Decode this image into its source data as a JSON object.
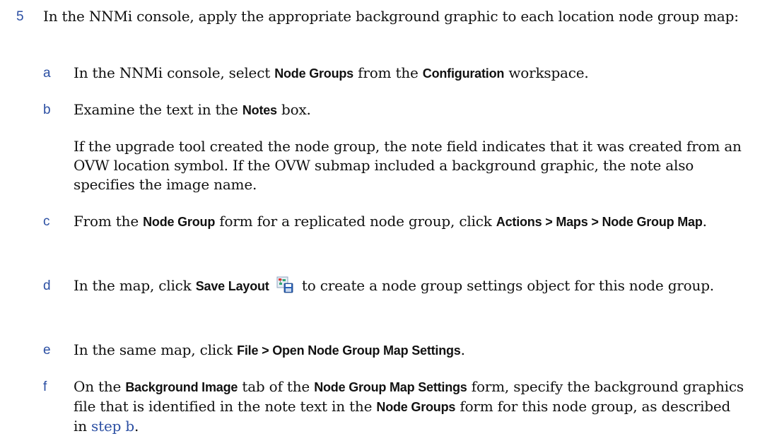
{
  "step": {
    "number": "5",
    "text": "In the NNMi console, apply the appropriate background graphic to each location node group map:"
  },
  "substeps": {
    "a": {
      "marker": "a",
      "t1": "In the NNMi console, select ",
      "b1": "Node Groups",
      "t2": " from the ",
      "b2": "Configuration",
      "t3": " workspace."
    },
    "b": {
      "marker": "b",
      "t1": "Examine the text in the ",
      "b1": "Notes",
      "t2": " box.",
      "para": "If the upgrade tool created the node group, the note field indicates that it was created from an OVW location symbol. If the OVW submap included a background graphic, the note also specifies the image name."
    },
    "c": {
      "marker": "c",
      "t1": "From the ",
      "b1": "Node Group",
      "t2": " form for a replicated node group, click ",
      "b2": "Actions > Maps > Node Group Map",
      "t3": "."
    },
    "d": {
      "marker": "d",
      "t1": "In the map, click ",
      "b1": "Save Layout",
      "t2": " to create a node group settings object for this node group."
    },
    "e": {
      "marker": "e",
      "t1": "In the same map, click ",
      "b1": "File > Open Node Group Map Settings",
      "t2": "."
    },
    "f": {
      "marker": "f",
      "t1": "On the ",
      "b1": "Background Image",
      "t2": " tab of the ",
      "b2": "Node Group Map Settings",
      "t3": " form, specify the background graphics file that is identified in the note text in the ",
      "b3": "Node Groups",
      "t4": " form for this node group, as described in ",
      "link": "step b",
      "t5": "."
    }
  },
  "icons": {
    "save_layout": "save-layout-icon"
  }
}
